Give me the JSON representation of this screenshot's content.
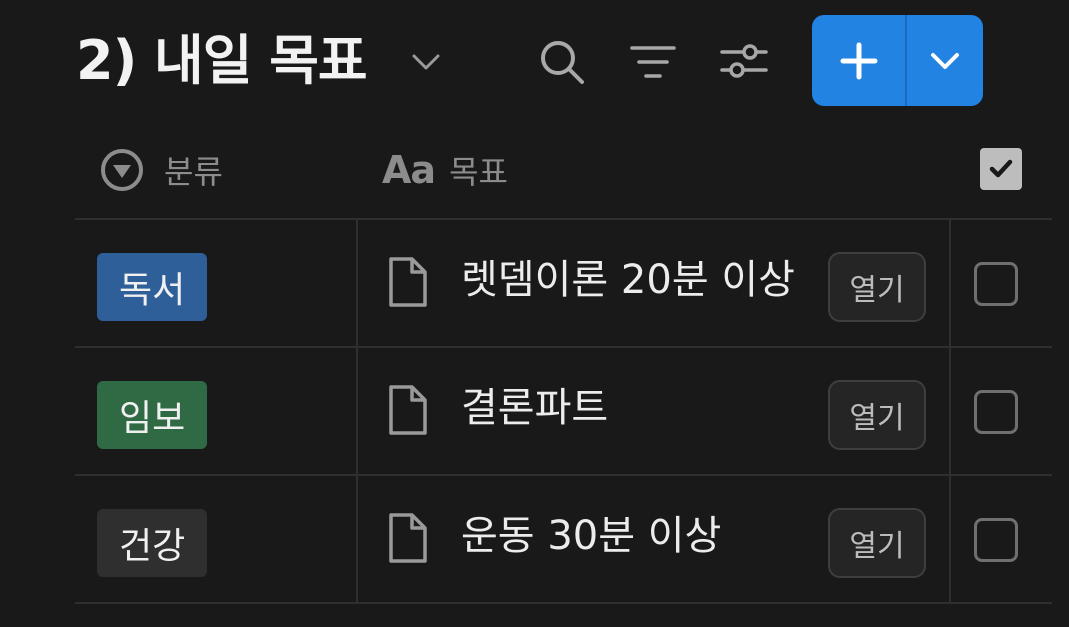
{
  "header": {
    "title": "2) 내일 목표",
    "new_button": {
      "plus_icon": "plus-icon",
      "dropdown_icon": "chevron-down-icon",
      "color": "#2383e2"
    },
    "tools": [
      "search-icon",
      "sort-icon",
      "settings-sliders-icon"
    ]
  },
  "columns": {
    "category": {
      "label": "분류",
      "icon": "select-icon"
    },
    "goal": {
      "label": "목표",
      "prefix": "Aa"
    },
    "done": {
      "icon": "checkbox-icon"
    }
  },
  "rows": [
    {
      "tag": "독서",
      "tag_color": "#2f5f98",
      "goal": "렛뎀이론 20분 이상",
      "open_label": "열기",
      "checked": false
    },
    {
      "tag": "임보",
      "tag_color": "#2f6a45",
      "goal": "결론파트",
      "open_label": "열기",
      "checked": false
    },
    {
      "tag": "건강",
      "tag_color": "#2f2f2f",
      "goal": "운동 30분 이상",
      "open_label": "열기",
      "checked": false
    }
  ]
}
